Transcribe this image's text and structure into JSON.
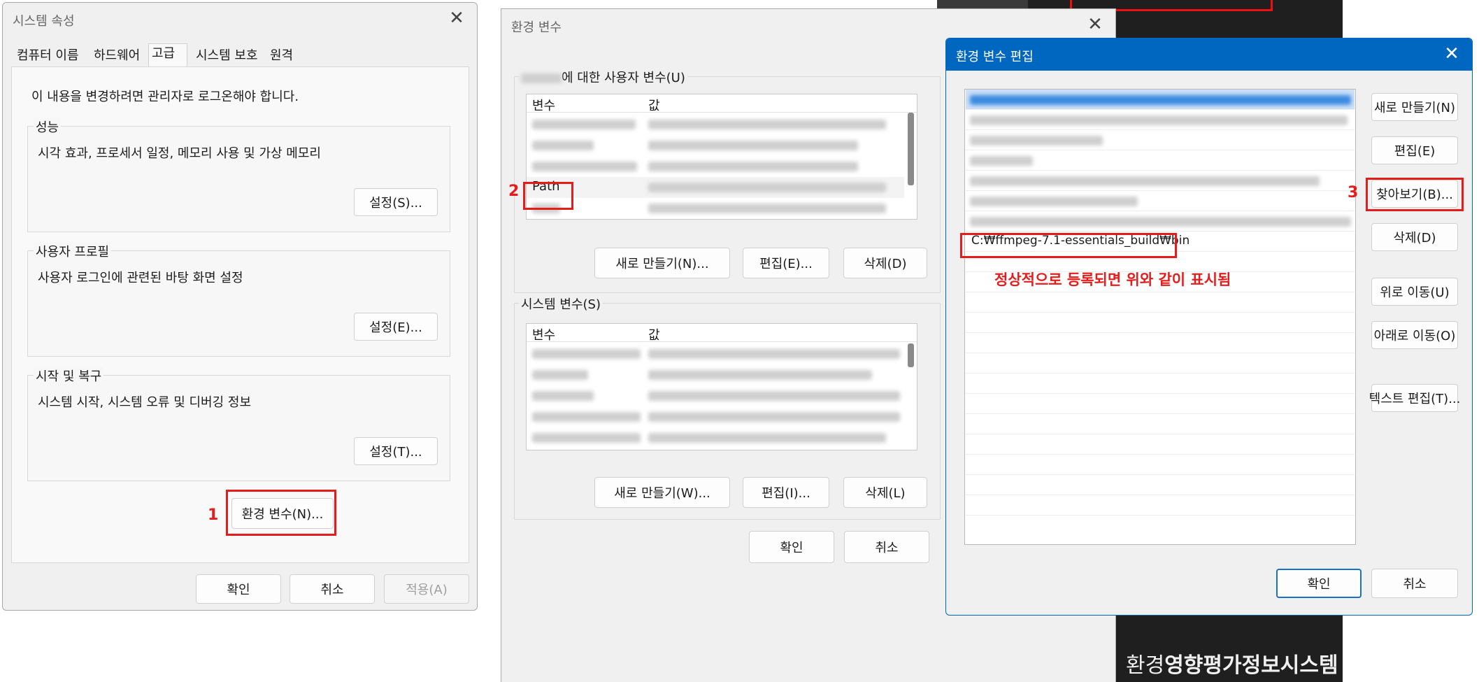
{
  "sysprops": {
    "title": "시스템 속성",
    "tabs": [
      "컴퓨터 이름",
      "하드웨어",
      "고급",
      "시스템 보호",
      "원격"
    ],
    "notice": "이 내용을 변경하려면 관리자로 로그온해야 합니다.",
    "groups": [
      {
        "label": "성능",
        "desc": "시각 효과, 프로세서 일정, 메모리 사용 및 가상 메모리",
        "button": "설정(S)..."
      },
      {
        "label": "사용자 프로필",
        "desc": "사용자 로그인에 관련된 바탕 화면 설정",
        "button": "설정(E)..."
      },
      {
        "label": "시작 및 복구",
        "desc": "시스템 시작, 시스템 오류 및 디버깅 정보",
        "button": "설정(T)..."
      }
    ],
    "env_button": "환경 변수(N)...",
    "ok": "확인",
    "cancel": "취소",
    "apply": "적용(A)"
  },
  "envvars": {
    "title": "환경 변수",
    "user_group_label": "에 대한 사용자 변수(U)",
    "col_var": "변수",
    "col_val": "값",
    "user_path": "Path",
    "user_new": "새로 만들기(N)...",
    "user_edit": "편집(E)...",
    "user_delete": "삭제(D)",
    "sys_group_label": "시스템 변수(S)",
    "sys_new": "새로 만들기(W)...",
    "sys_edit": "편집(I)...",
    "sys_delete": "삭제(L)",
    "ok": "확인",
    "cancel": "취소"
  },
  "editenv": {
    "title": "환경 변수 편집",
    "new_entry": "C:₩ffmpeg-7.1-essentials_build₩bin",
    "annotation": "정상적으로 등록되면 위와 같이 표시됨",
    "btn_new": "새로 만들기(N)",
    "btn_edit": "편집(E)",
    "btn_browse": "찾아보기(B)...",
    "btn_delete": "삭제(D)",
    "btn_up": "위로 이동(U)",
    "btn_down": "아래로 이동(O)",
    "btn_text": "텍스트 편집(T)...",
    "ok": "확인",
    "cancel": "취소"
  },
  "markers": {
    "one": "1",
    "two": "2",
    "three": "3"
  },
  "background_caption": {
    "light": "환경",
    "bold": "영향평가정보시스템"
  },
  "colors": {
    "accent": "#0067c0",
    "annotation_red": "#e51c1c"
  }
}
